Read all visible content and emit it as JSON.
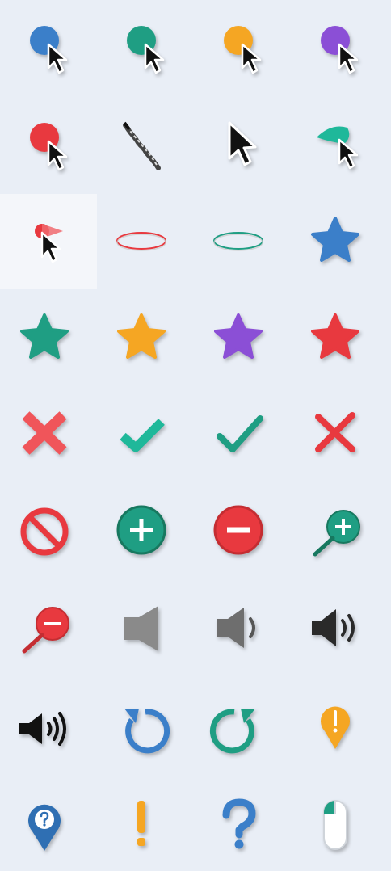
{
  "title": "",
  "colors": {
    "background": "#e9eef6",
    "blue": "#3b7fc9",
    "teal": "#1f9e83",
    "orange": "#f5a623",
    "purple": "#8b4fd6",
    "red": "#e8393f",
    "gray": "#8a8a8a",
    "dark": "#2a2a2a",
    "white": "#ffffff"
  },
  "rows": [
    [
      "cursor-blue-dot-icon",
      "cursor-teal-dot-icon",
      "cursor-orange-dot-icon",
      "cursor-purple-dot-icon"
    ],
    [
      "cursor-red-dot-icon",
      "sketchy-trail-icon",
      "cursor-arrow-icon",
      "cursor-teal-drop-icon"
    ],
    [
      "cursor-red-drop-icon",
      "red-ellipse-icon",
      "teal-ellipse-icon",
      "star-blue-icon"
    ],
    [
      "star-teal-icon",
      "star-orange-icon",
      "star-purple-icon",
      "star-red-icon"
    ],
    [
      "x-red-bold-icon",
      "check-teal-icon",
      "check-teal-thin-icon",
      "x-red-thin-icon"
    ],
    [
      "no-entry-icon",
      "plus-circle-icon",
      "minus-circle-icon",
      "zoom-in-icon"
    ],
    [
      "zoom-out-icon",
      "speaker-mute-icon",
      "speaker-low-icon",
      "speaker-medium-icon"
    ],
    [
      "speaker-high-icon",
      "rotate-blue-icon",
      "rotate-teal-icon",
      "alert-pin-icon"
    ],
    [
      "help-pin-icon",
      "exclamation-icon",
      "question-icon",
      "mouse-icon"
    ]
  ]
}
